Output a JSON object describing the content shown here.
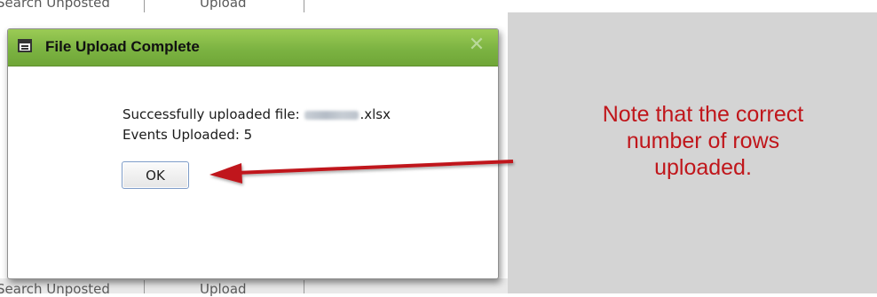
{
  "background": {
    "tab_search_unposted": "Search Unposted",
    "tab_upload": "Upload"
  },
  "dialog": {
    "title": "File Upload Complete",
    "close_glyph": "✕",
    "message_prefix": "Successfully uploaded file:",
    "file_extension": ".xlsx",
    "events_label": "Events Uploaded: 5",
    "ok_label": "OK"
  },
  "annotation": {
    "note_line1": "Note that the correct",
    "note_line2": "number of rows",
    "note_line3": "uploaded.",
    "color": "#c0161b"
  },
  "colors": {
    "titlebar_green": "#7cb342",
    "side_gray": "#d4d4d4"
  },
  "icons": {
    "title_icon": "window-icon",
    "close_icon": "close-icon",
    "arrow": "arrow-left"
  }
}
